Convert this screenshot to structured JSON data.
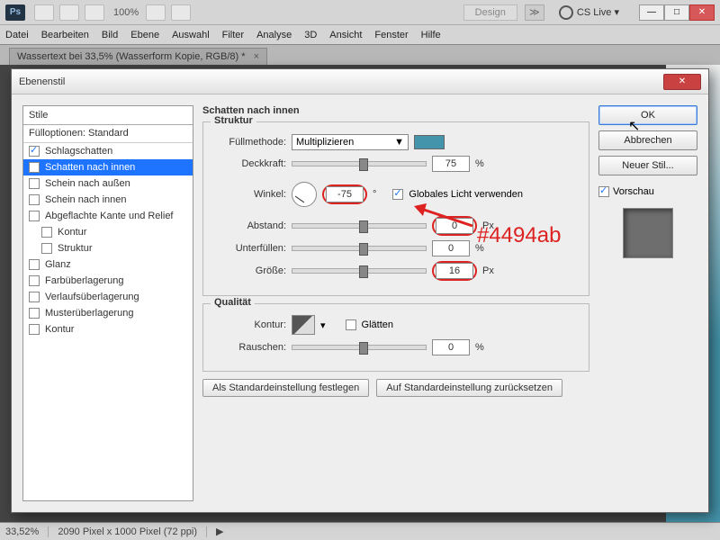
{
  "topbar": {
    "zoom": "100%",
    "design": "Design",
    "cslive": "CS Live ▾"
  },
  "menu": [
    "Datei",
    "Bearbeiten",
    "Bild",
    "Ebene",
    "Auswahl",
    "Filter",
    "Analyse",
    "3D",
    "Ansicht",
    "Fenster",
    "Hilfe"
  ],
  "docTab": "Wassertext bei 33,5% (Wasserform Kopie, RGB/8) *",
  "status": {
    "zoom": "33,52%",
    "info": "2090 Pixel x 1000 Pixel (72 ppi)"
  },
  "dlg": {
    "title": "Ebenenstil",
    "stylesHead": "Stile",
    "blendHead": "Fülloptionen: Standard",
    "items": [
      {
        "label": "Schlagschatten",
        "checked": true,
        "sel": false
      },
      {
        "label": "Schatten nach innen",
        "checked": true,
        "sel": true
      },
      {
        "label": "Schein nach außen",
        "checked": false,
        "sel": false
      },
      {
        "label": "Schein nach innen",
        "checked": false,
        "sel": false
      },
      {
        "label": "Abgeflachte Kante und Relief",
        "checked": false,
        "sel": false
      },
      {
        "label": "Kontur",
        "checked": false,
        "sel": false,
        "sub": true
      },
      {
        "label": "Struktur",
        "checked": false,
        "sel": false,
        "sub": true
      },
      {
        "label": "Glanz",
        "checked": false,
        "sel": false
      },
      {
        "label": "Farbüberlagerung",
        "checked": false,
        "sel": false
      },
      {
        "label": "Verlaufsüberlagerung",
        "checked": false,
        "sel": false
      },
      {
        "label": "Musterüberlagerung",
        "checked": false,
        "sel": false
      },
      {
        "label": "Kontur",
        "checked": false,
        "sel": false
      }
    ],
    "sectionTitle": "Schatten nach innen",
    "grpStruct": "Struktur",
    "grpQual": "Qualität",
    "labels": {
      "blend": "Füllmethode:",
      "opacity": "Deckkraft:",
      "angle": "Winkel:",
      "globalLight": "Globales Licht verwenden",
      "distance": "Abstand:",
      "choke": "Unterfüllen:",
      "size": "Größe:",
      "contour": "Kontur:",
      "smooth": "Glätten",
      "noise": "Rauschen:",
      "px": "Px",
      "pct": "%",
      "deg": "°"
    },
    "values": {
      "blendMode": "Multiplizieren",
      "opacity": "75",
      "angle": "-75",
      "distance": "0",
      "choke": "0",
      "size": "16",
      "noise": "0",
      "globalLight": true,
      "smooth": false,
      "color": "#4494ab"
    },
    "btns": {
      "default": "Als Standardeinstellung festlegen",
      "reset": "Auf Standardeinstellung zurücksetzen"
    },
    "right": {
      "ok": "OK",
      "cancel": "Abbrechen",
      "newStyle": "Neuer Stil...",
      "preview": "Vorschau"
    }
  },
  "annotation": "#4494ab"
}
